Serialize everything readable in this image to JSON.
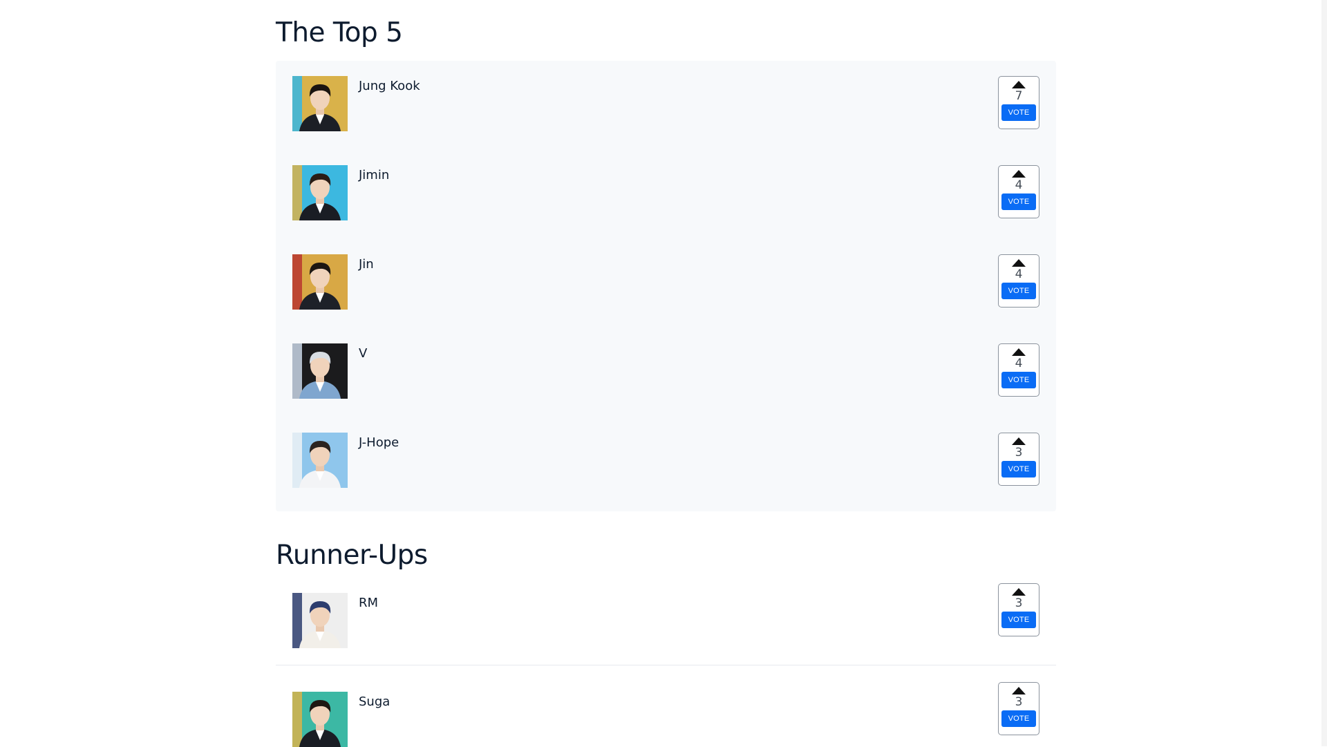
{
  "top5": {
    "title": "The Top 5",
    "items": [
      {
        "name": "Jung Kook",
        "votes": "7",
        "vote_label": "VOTE",
        "bg": "#d9b24a",
        "accent": "#34b6e4",
        "hair": "#1a1410",
        "suit": "#1c1f26"
      },
      {
        "name": "Jimin",
        "votes": "4",
        "vote_label": "VOTE",
        "bg": "#3cb8e0",
        "accent": "#d9b24a",
        "hair": "#2a1d16",
        "suit": "#1a1d24"
      },
      {
        "name": "Jin",
        "votes": "4",
        "vote_label": "VOTE",
        "bg": "#d8a845",
        "accent": "#b8362f",
        "hair": "#1d1712",
        "suit": "#1e2128"
      },
      {
        "name": "V",
        "votes": "4",
        "vote_label": "VOTE",
        "bg": "#1b1b1d",
        "accent": "#c9d6e6",
        "hair": "#d8dde3",
        "suit": "#7fa6cf"
      },
      {
        "name": "J-Hope",
        "votes": "3",
        "vote_label": "VOTE",
        "bg": "#8fc6ec",
        "accent": "#eef2f6",
        "hair": "#2b2420",
        "suit": "#f3f4f6"
      }
    ]
  },
  "runner_ups": {
    "title": "Runner-Ups",
    "items": [
      {
        "name": "RM",
        "votes": "3",
        "vote_label": "VOTE",
        "bg": "#eeeeee",
        "accent": "#2d3d6e",
        "hair": "#2d3d6e",
        "suit": "#f2efe9"
      },
      {
        "name": "Suga",
        "votes": "3",
        "vote_label": "VOTE",
        "bg": "#3cb8a4",
        "accent": "#d9b24a",
        "hair": "#1e1712",
        "suit": "#1a1d24"
      }
    ]
  }
}
